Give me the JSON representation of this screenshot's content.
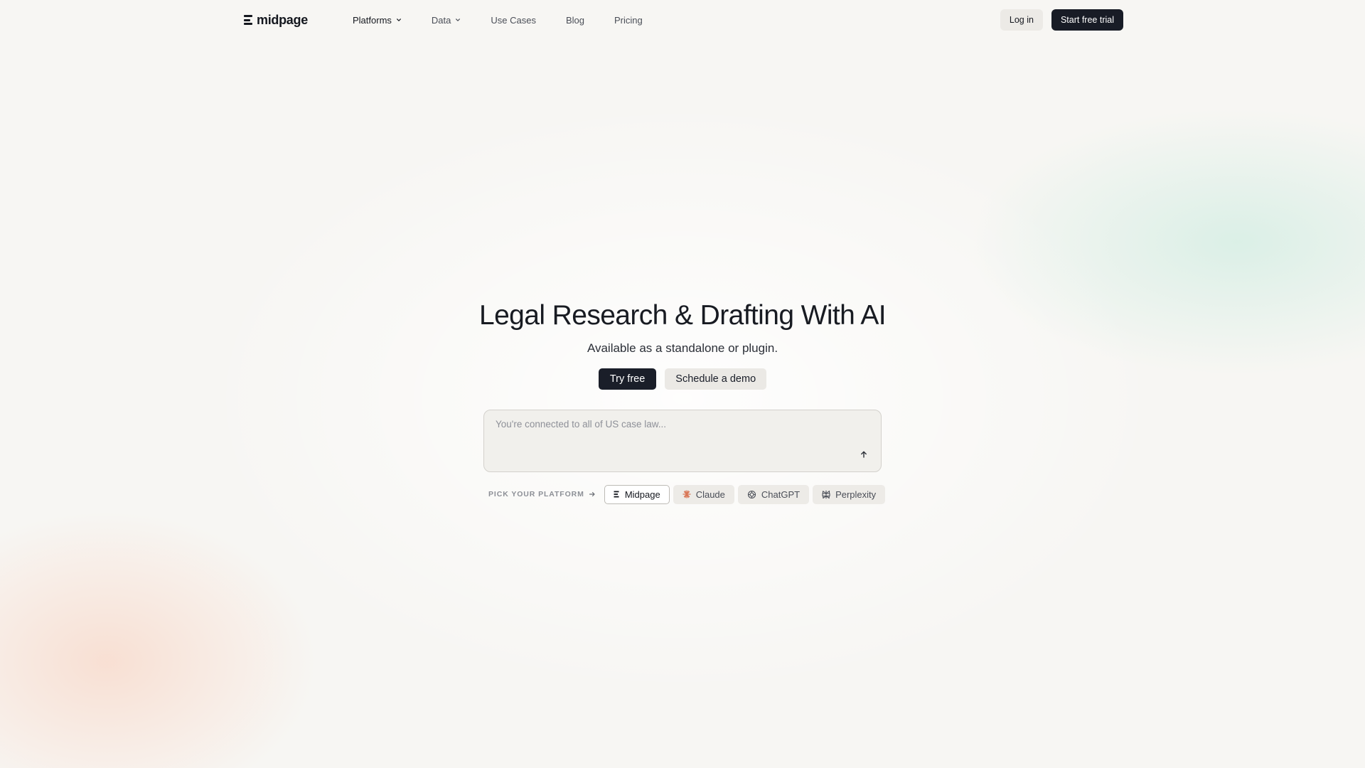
{
  "brand": {
    "name": "midpage"
  },
  "nav": {
    "links": [
      {
        "label": "Platforms",
        "has_dropdown": true,
        "active": true
      },
      {
        "label": "Data",
        "has_dropdown": true,
        "active": false
      },
      {
        "label": "Use Cases",
        "has_dropdown": false,
        "active": false
      },
      {
        "label": "Blog",
        "has_dropdown": false,
        "active": false
      },
      {
        "label": "Pricing",
        "has_dropdown": false,
        "active": false
      }
    ],
    "login_label": "Log in",
    "trial_label": "Start free trial"
  },
  "hero": {
    "title": "Legal Research & Drafting With AI",
    "subtitle": "Available as a standalone or plugin.",
    "primary_cta": "Try free",
    "secondary_cta": "Schedule a demo"
  },
  "prompt": {
    "placeholder": "You're connected to all of US case law...",
    "value": ""
  },
  "picker": {
    "label": "PICK YOUR PLATFORM",
    "options": [
      {
        "label": "Midpage",
        "icon": "midpage-logo-icon",
        "selected": true
      },
      {
        "label": "Claude",
        "icon": "claude-logo-icon",
        "selected": false
      },
      {
        "label": "ChatGPT",
        "icon": "chatgpt-logo-icon",
        "selected": false
      },
      {
        "label": "Perplexity",
        "icon": "perplexity-logo-icon",
        "selected": false
      }
    ]
  },
  "colors": {
    "primary_dark": "#181c26",
    "claude_accent": "#d97757",
    "background": "#f7f6f3"
  }
}
